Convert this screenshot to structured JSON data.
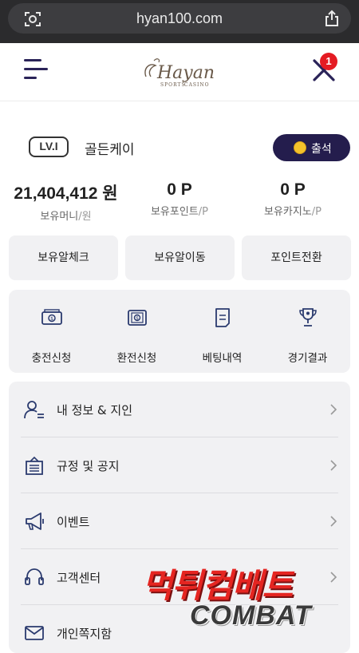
{
  "browser": {
    "url": "hyan100.com"
  },
  "header": {
    "logo_text": "Hayan",
    "logo_sub": "SPORTS CASINO",
    "notification_count": "1"
  },
  "user": {
    "level": "LV.I",
    "name": "골든케이",
    "attend_label": "출석"
  },
  "stats": [
    {
      "value": "21,404,412 원",
      "label": "보유머니",
      "unit": "/원"
    },
    {
      "value": "0 P",
      "label": "보유포인트",
      "unit": "/P"
    },
    {
      "value": "0 P",
      "label": "보유카지노",
      "unit": "/P"
    }
  ],
  "actions": [
    "보유알체크",
    "보유알이동",
    "포인트전환"
  ],
  "quick_menu": [
    {
      "label": "충전신청",
      "icon": "deposit-icon"
    },
    {
      "label": "환전신청",
      "icon": "withdraw-icon"
    },
    {
      "label": "베팅내역",
      "icon": "betting-history-icon"
    },
    {
      "label": "경기결과",
      "icon": "trophy-icon"
    }
  ],
  "menu": [
    {
      "label": "내 정보 & 지인",
      "icon": "user-icon"
    },
    {
      "label": "규정 및 공지",
      "icon": "notice-board-icon"
    },
    {
      "label": "이벤트",
      "icon": "megaphone-icon"
    },
    {
      "label": "고객센터",
      "icon": "headset-icon"
    },
    {
      "label": "개인쪽지함",
      "icon": "mail-icon"
    }
  ],
  "watermark": {
    "korean": "먹튀컴배트",
    "english": "COMBAT"
  },
  "colors": {
    "brand_dark": "#241d4d",
    "badge_red": "#e41b23",
    "icon_navy": "#2a3a6e"
  }
}
